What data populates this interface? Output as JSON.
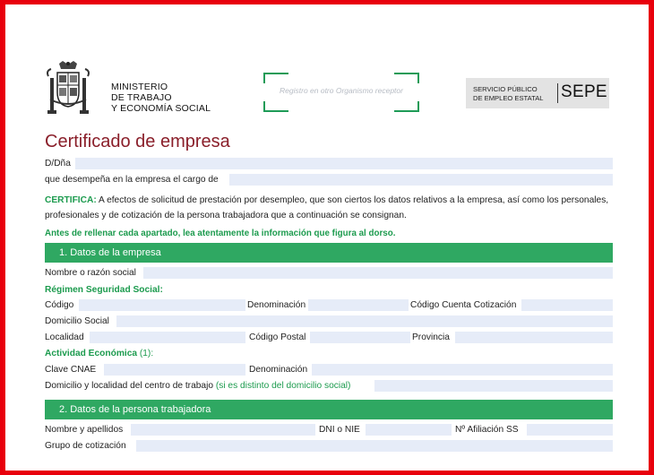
{
  "header": {
    "ministry_line1": "MINISTERIO",
    "ministry_line2": "DE TRABAJO",
    "ministry_line3": "Y ECONOMÍA SOCIAL",
    "stamp_text": "Registro en otro Organismo receptor",
    "sepe_small_line1": "SERVICIO PÚBLICO",
    "sepe_small_line2": "DE EMPLEO ESTATAL",
    "sepe_big": "SEPE"
  },
  "form": {
    "title": "Certificado de empresa",
    "dna_label": "D/Dña",
    "cargo_label": "que desempeña en la empresa el cargo de",
    "certifica_label": "CERTIFICA:",
    "certifica_text_1": " A efectos de solicitud de prestación por desempleo, que son ciertos los datos relativos a la empresa, así como los personales,",
    "certifica_text_2": "profesionales y de cotización de la persona trabajadora que a continuación se consignan.",
    "warning": "Antes de rellenar cada apartado, lea atentamente la información que figura al dorso."
  },
  "section1": {
    "heading": "1.  Datos de la empresa",
    "nombre_label": "Nombre o razón social",
    "regimen_label": "Régimen Seguridad Social:",
    "codigo_label": "Código",
    "denominacion_label": "Denominación",
    "ccc_label": "Código Cuenta Cotización",
    "domicilio_label": "Domicilio Social",
    "localidad_label": "Localidad",
    "cp_label": "Código Postal",
    "provincia_label": "Provincia",
    "actividad_label": "Actividad Económica",
    "actividad_note": " (1):",
    "cnae_label": "Clave CNAE",
    "denominacion2_label": "Denominación",
    "centro_label": "Domicilio y localidad del centro de trabajo",
    "centro_note": " (si es distinto del domicilio social)"
  },
  "section2": {
    "heading": "2.  Datos de la persona trabajadora",
    "nombre_label": "Nombre y apellidos",
    "dni_label": "DNI o NIE",
    "afiliacion_label": "Nº  Afiliación SS",
    "grupo_label": "Grupo de cotización"
  }
}
